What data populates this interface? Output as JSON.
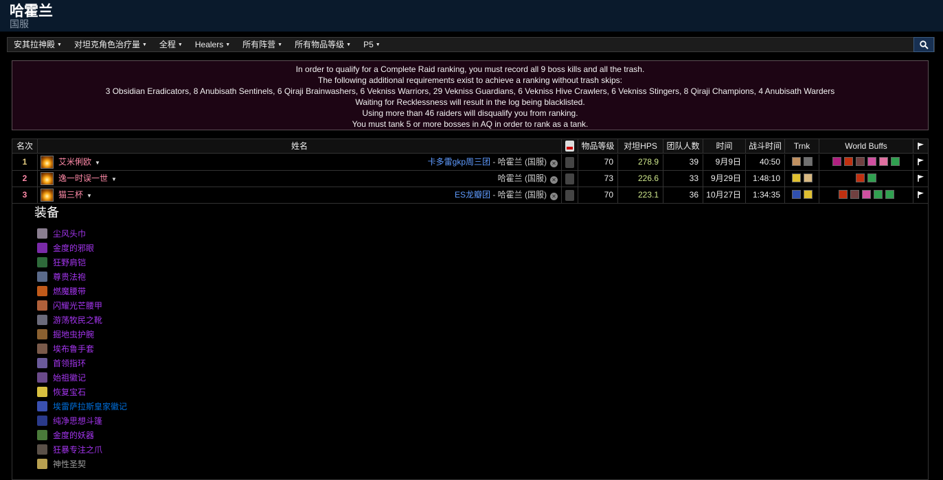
{
  "header": {
    "title": "哈霍兰",
    "subtitle": "国服"
  },
  "nav": {
    "items": [
      "安其拉神殿",
      "对坦克角色治疗量",
      "全程",
      "Healers",
      "所有阵营",
      "所有物品等级",
      "P5"
    ]
  },
  "notice": {
    "lines": [
      "In order to qualify for a Complete Raid ranking, you must record all 9 boss kills and all the trash.",
      "The following additional requirements exist to achieve a ranking without trash skips:",
      "3 Obsidian Eradicators, 8 Anubisath Sentinels, 6 Qiraji Brainwashers, 6 Vekniss Warriors, 29 Vekniss Guardians, 6 Vekniss Hive Crawlers, 6 Vekniss Stingers, 8 Qiraji Champions, 4 Anubisath Warders",
      "Waiting for Recklessness will result in the log being blacklisted.",
      "Using more than 46 raiders will disqualify you from ranking.",
      "You must tank 5 or more bosses in AQ in order to rank as a tank."
    ]
  },
  "table": {
    "headers": {
      "rank": "名次",
      "name": "姓名",
      "ilvl": "物品等级",
      "hps": "对坦HPS",
      "raiders": "团队人数",
      "date": "时间",
      "duration": "战斗时间",
      "trnk": "Trnk",
      "buffs": "World Buffs"
    },
    "rows": [
      {
        "rank": "1",
        "name": "艾米俐欧",
        "guild": "卡多雷gkp周三团",
        "server": "哈霍兰 (国服)",
        "ilvl": "70",
        "hps": "278.9",
        "raiders": "39",
        "date": "9月9日",
        "duration": "40:50"
      },
      {
        "rank": "2",
        "name": "逸一时误一世",
        "guild": "",
        "server": "哈霍兰 (国服)",
        "ilvl": "73",
        "hps": "226.6",
        "raiders": "33",
        "date": "9月29日",
        "duration": "1:48:10"
      },
      {
        "rank": "3",
        "name": "猫三杯",
        "guild": "ES龙瓣团",
        "server": "哈霍兰 (国服)",
        "ilvl": "70",
        "hps": "223.1",
        "raiders": "36",
        "date": "10月27日",
        "duration": "1:34:35"
      }
    ],
    "separator": " - "
  },
  "gear": {
    "title": "装备",
    "items": [
      {
        "name": "尘风头巾",
        "quality": "epic",
        "color": "#8a7e90"
      },
      {
        "name": "金度的邪眼",
        "quality": "epic",
        "color": "#7a2aa8"
      },
      {
        "name": "狂野肩铠",
        "quality": "epic",
        "color": "#2e6a3a"
      },
      {
        "name": "尊贵法袍",
        "quality": "epic",
        "color": "#5a6a8a"
      },
      {
        "name": "燃魔腰带",
        "quality": "epic",
        "color": "#c05a1a"
      },
      {
        "name": "闪耀光芒腰甲",
        "quality": "epic",
        "color": "#b0603a"
      },
      {
        "name": "游荡牧民之靴",
        "quality": "epic",
        "color": "#6a6a7a"
      },
      {
        "name": "掘地虫护腕",
        "quality": "epic",
        "color": "#8a6030"
      },
      {
        "name": "埃布鲁手套",
        "quality": "epic",
        "color": "#7a5a4a"
      },
      {
        "name": "首领指环",
        "quality": "epic",
        "color": "#6a5a9a"
      },
      {
        "name": "始祖徽记",
        "quality": "epic",
        "color": "#6a4a8a"
      },
      {
        "name": "恢复宝石",
        "quality": "epic",
        "color": "#d8c040"
      },
      {
        "name": "埃雷萨拉斯皇家徽记",
        "quality": "rare",
        "color": "#3a50b0"
      },
      {
        "name": "纯净思想斗篷",
        "quality": "epic",
        "color": "#2a3a8a"
      },
      {
        "name": "金度的妖器",
        "quality": "epic",
        "color": "#4a7a3a"
      },
      {
        "name": "狂暴专注之爪",
        "quality": "epic",
        "color": "#5a5048"
      },
      {
        "name": "神性圣契",
        "quality": "common",
        "color": "#b8a050"
      }
    ]
  },
  "icons": {
    "trinkets": [
      [
        "#c09060",
        "#707070"
      ],
      [
        "#e0c030",
        "#d8b880"
      ],
      [
        "#3050b0",
        "#e0c030"
      ]
    ],
    "buffs": [
      [
        "#b02080",
        "#c03010",
        "#704040",
        "#d050a0",
        "#e070a0",
        "#30a050"
      ],
      [
        "#c03010",
        "#30a050"
      ],
      [
        "#c03010",
        "#704040",
        "#d050a0",
        "#30a050",
        "#30a050"
      ]
    ]
  }
}
